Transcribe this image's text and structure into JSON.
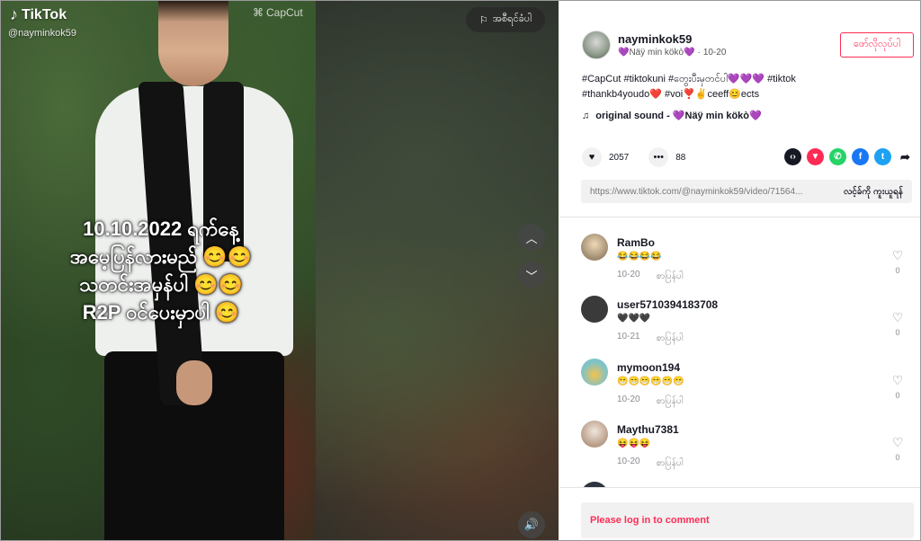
{
  "video": {
    "app_name": "TikTok",
    "handle": "@nayminkok59",
    "watermark": "CapCut",
    "overlay_lines": [
      "10.10.2022 ရက်နေ့",
      "အမေ့ပြန်လားမည် 😊😊",
      "သတင်းအမှန်ပါ 😊😊",
      "R2P ဝင်ပေးမှာပါ 😊"
    ],
    "report_label": "အစီရင်ခံပါ"
  },
  "author": {
    "username": "nayminkok59",
    "display_name": "💜Näÿ min kökò💜",
    "date": "10-20",
    "follow_label": "ဖော်လိုလုပ်ပါ"
  },
  "caption": {
    "line1": "#CapCut #tiktokuni #တွေးပီးမှတင်ပါ💜💜💜 #tiktok",
    "line2": "#thankb4youdo❤️ #voi❣️✌️ceeff😊ects"
  },
  "sound": {
    "label": "original sound - 💜Näÿ min kökò💜"
  },
  "stats": {
    "likes": "2057",
    "comments": "88"
  },
  "share": {
    "icons": [
      "embed-icon",
      "tiktok-share-icon",
      "whatsapp-icon",
      "facebook-icon",
      "twitter-icon",
      "forward-icon"
    ],
    "colors": {
      "embed": "#161823",
      "tiktok": "#fe2c55",
      "whatsapp": "#25d366",
      "facebook": "#1877f2",
      "twitter": "#1da1f2"
    }
  },
  "link": {
    "url": "https://www.tiktok.com/@nayminkok59/video/71564...",
    "copy_label": "လင့်ခ်ကို ကူးယူရန်"
  },
  "comments": [
    {
      "user": "RamBo",
      "text": "😂😂😂😂",
      "date": "10-20",
      "reply": "စာပြန်ပါ",
      "likes": "0"
    },
    {
      "user": "user5710394183708",
      "text": "🖤🖤🖤",
      "date": "10-21",
      "reply": "စာပြန်ပါ",
      "likes": "0"
    },
    {
      "user": "mymoon194",
      "text": "😁😁😁😁😁😁",
      "date": "10-20",
      "reply": "စာပြန်ပါ",
      "likes": "0"
    },
    {
      "user": "Maythu7381",
      "text": "😝😝😝",
      "date": "10-20",
      "reply": "စာပြန်ပါ",
      "likes": "0"
    }
  ],
  "login_prompt": "Please log in to comment",
  "colors": {
    "accent": "#fe2c55",
    "text": "#161823",
    "muted": "#8a8b91"
  }
}
